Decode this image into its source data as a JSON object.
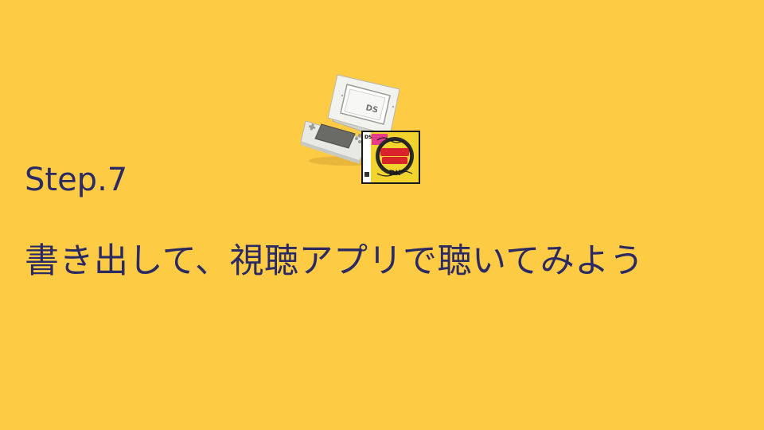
{
  "slide": {
    "background_color": "#FECB45",
    "text_color": "#2C2A63",
    "step_label": "Step.7",
    "step_text": "書き出して、視聴アプリで聴いてみよう",
    "illustration": {
      "icon": "nintendo-ds-console-with-game-cartridge"
    }
  }
}
